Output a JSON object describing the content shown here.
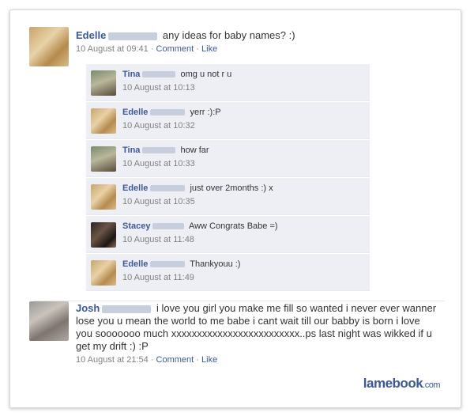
{
  "post": {
    "author": "Edelle",
    "text": "any ideas for baby names? :)",
    "time": "10 August at 09:41",
    "sep": "·",
    "comment_label": "Comment",
    "like_label": "Like"
  },
  "comments": [
    {
      "author": "Tina",
      "text": "omg u not r u",
      "time": "10 August at 10:13"
    },
    {
      "author": "Edelle",
      "text": "yerr :):P",
      "time": "10 August at 10:32"
    },
    {
      "author": "Tina",
      "text": "how far",
      "time": "10 August at 10:33"
    },
    {
      "author": "Edelle",
      "text": "just over 2months :) x",
      "time": "10 August at 10:35"
    },
    {
      "author": "Stacey",
      "text": "Aww Congrats Babe =)",
      "time": "10 August at 11:48"
    },
    {
      "author": "Edelle",
      "text": "Thankyouu :)",
      "time": "10 August at 11:49"
    }
  ],
  "post2": {
    "author": "Josh",
    "text": "i love you girl you make me fill so wanted i never ever wanner lose you u mean the world to me babe i cant wait till our babby is born i love you sooooooo much xxxxxxxxxxxxxxxxxxxxxxxxx..ps last night was wikked if u get my drift :) :P",
    "time": "10 August at 21:54",
    "comment_label": "Comment",
    "like_label": "Like"
  },
  "watermark": {
    "brand": "lamebook",
    "tld": ".com"
  },
  "colors": {
    "link": "#3b5998",
    "comment_bg": "#edeff4",
    "meta": "#808080"
  }
}
